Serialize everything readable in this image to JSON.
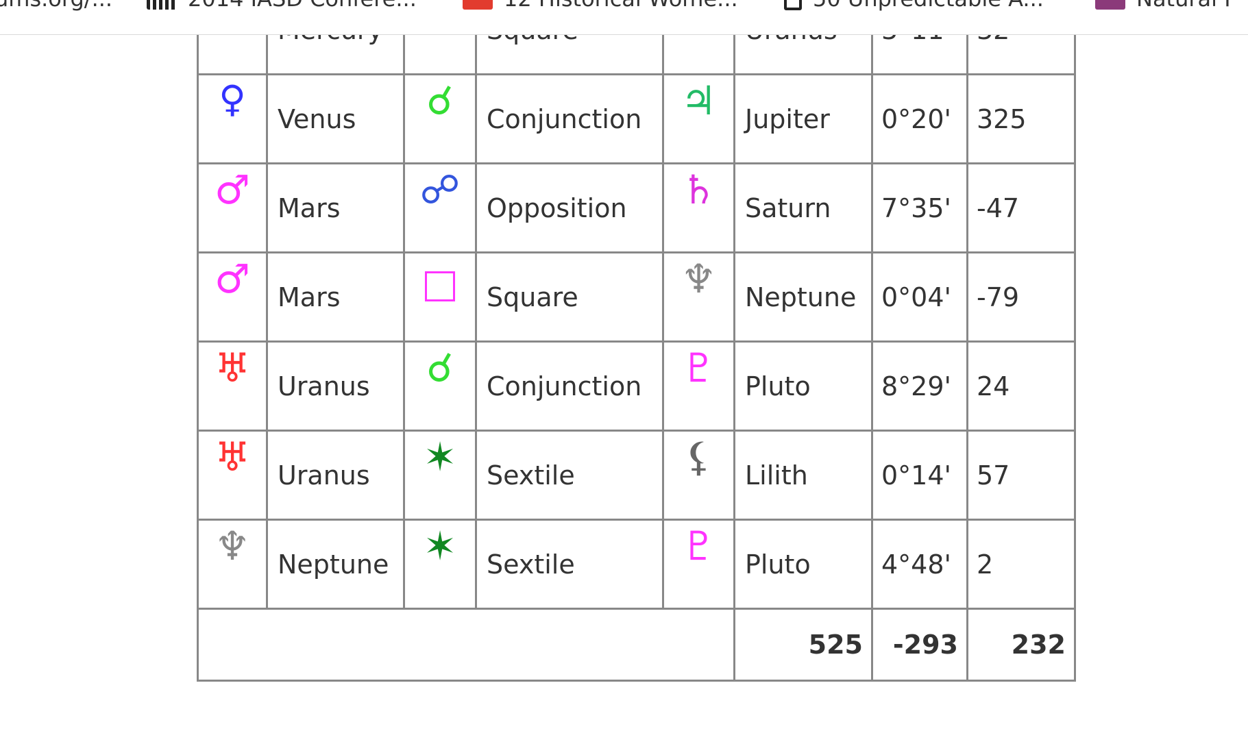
{
  "bookmarks": [
    {
      "label": "ums.org/...",
      "icon": "bookmark-favicon"
    },
    {
      "label": "2014 IASD Confere...",
      "icon": "asd-favicon"
    },
    {
      "label": "12 Historical Wome...",
      "icon": "bi-favicon"
    },
    {
      "label": "50 Unpredictable A...",
      "icon": "book-favicon"
    },
    {
      "label": "Natural F",
      "icon": "natural-favicon"
    }
  ],
  "colors": {
    "sun_blue": "#3333ff",
    "mars_magenta": "#ff33ff",
    "uranus_red": "#ff3333",
    "conjunction_green": "#33dd33",
    "opposition_blue": "#3355dd",
    "sextile_darkgreen": "#118822",
    "jupiter_green": "#22bb66",
    "saturn_magenta": "#dd33dd",
    "neptune_gray": "#888888",
    "lilith_gray": "#666666",
    "border_gray": "#888888"
  },
  "table": {
    "partial_row": {
      "planet1_glyph": "☿",
      "planet1": "Mercury",
      "aspect_glyph": "□",
      "aspect": "Square",
      "planet2_glyph": "♅",
      "planet2": "Uranus",
      "orb": "3°11'",
      "points": "32"
    },
    "rows": [
      {
        "p1_glyph": "♀",
        "p1": "Venus",
        "a_glyph": "☌",
        "aspect": "Conjunction",
        "p2_glyph": "♃",
        "p2": "Jupiter",
        "orb": "0°20'",
        "points": "325"
      },
      {
        "p1_glyph": "♂",
        "p1": "Mars",
        "a_glyph": "☍",
        "aspect": "Opposition",
        "p2_glyph": "♄",
        "p2": "Saturn",
        "orb": "7°35'",
        "points": "-47"
      },
      {
        "p1_glyph": "♂",
        "p1": "Mars",
        "a_glyph": "□",
        "aspect": "Square",
        "p2_glyph": "♆",
        "p2": "Neptune",
        "orb": "0°04'",
        "points": "-79"
      },
      {
        "p1_glyph": "♅",
        "p1": "Uranus",
        "a_glyph": "☌",
        "aspect": "Conjunction",
        "p2_glyph": "♇",
        "p2": "Pluto",
        "orb": "8°29'",
        "points": "24"
      },
      {
        "p1_glyph": "♅",
        "p1": "Uranus",
        "a_glyph": "✶",
        "aspect": "Sextile",
        "p2_glyph": "⚸",
        "p2": "Lilith",
        "orb": "0°14'",
        "points": "57"
      },
      {
        "p1_glyph": "♆",
        "p1": "Neptune",
        "a_glyph": "✶",
        "aspect": "Sextile",
        "p2_glyph": "♇",
        "p2": "Pluto",
        "orb": "4°48'",
        "points": "2"
      }
    ],
    "totals": {
      "positive": "525",
      "negative": "-293",
      "net": "232"
    }
  }
}
